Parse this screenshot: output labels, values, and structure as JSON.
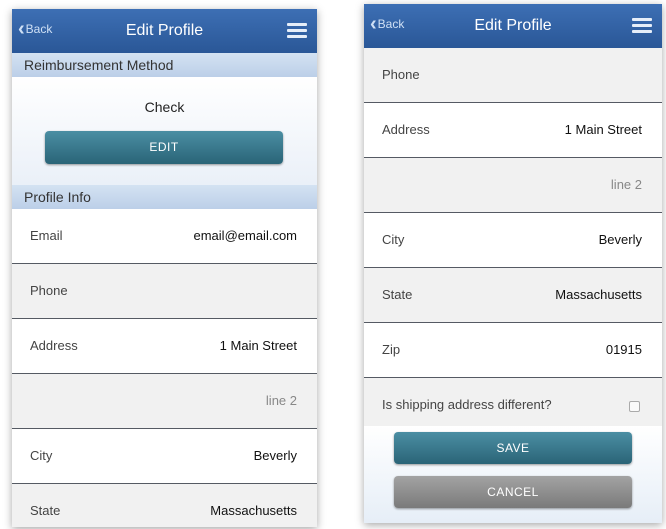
{
  "left": {
    "navbar": {
      "back_label": "Back",
      "title": "Edit Profile"
    },
    "reimbursement": {
      "header": "Reimbursement Method",
      "value": "Check",
      "edit_label": "EDIT"
    },
    "profile": {
      "header": "Profile Info",
      "rows": [
        {
          "label": "Email",
          "value": "email@email.com"
        },
        {
          "label": "Phone",
          "value": ""
        },
        {
          "label": "Address",
          "value": "1 Main Street"
        },
        {
          "label": "",
          "value": "line 2"
        },
        {
          "label": "City",
          "value": "Beverly"
        },
        {
          "label": "State",
          "value": "Massachusetts"
        }
      ]
    }
  },
  "right": {
    "navbar": {
      "back_label": "Back",
      "title": "Edit Profile"
    },
    "rows": [
      {
        "label": "Phone",
        "value": ""
      },
      {
        "label": "Address",
        "value": "1 Main Street"
      },
      {
        "label": "",
        "value": "line 2"
      },
      {
        "label": "City",
        "value": "Beverly"
      },
      {
        "label": "State",
        "value": "Massachusetts"
      },
      {
        "label": "Zip",
        "value": "01915"
      }
    ],
    "shipping_question": "Is shipping address different?",
    "save_label": "SAVE",
    "cancel_label": "CANCEL"
  },
  "colors": {
    "navbar": "#2f5f9f",
    "section_header": "#c6d7ec",
    "primary_button": "#2f6e83",
    "cancel_button": "#8e8e8e"
  }
}
